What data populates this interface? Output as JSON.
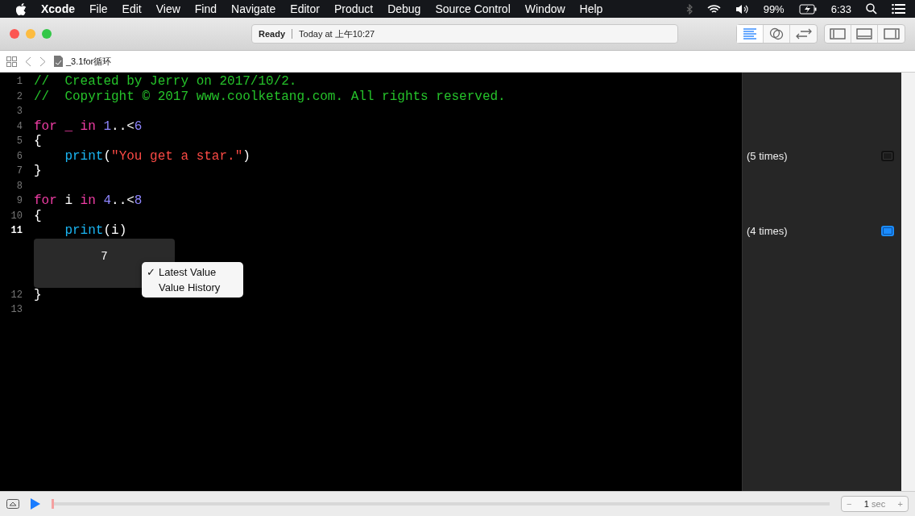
{
  "menu_bar": {
    "items": [
      {
        "label": "Xcode",
        "kind": "app"
      },
      {
        "label": "File",
        "kind": "menu"
      },
      {
        "label": "Edit",
        "kind": "menu"
      },
      {
        "label": "View",
        "kind": "menu"
      },
      {
        "label": "Find",
        "kind": "menu"
      },
      {
        "label": "Navigate",
        "kind": "menu"
      },
      {
        "label": "Editor",
        "kind": "menu"
      },
      {
        "label": "Product",
        "kind": "menu"
      },
      {
        "label": "Debug",
        "kind": "menu"
      },
      {
        "label": "Source Control",
        "kind": "menu"
      },
      {
        "label": "Window",
        "kind": "menu"
      },
      {
        "label": "Help",
        "kind": "menu"
      }
    ],
    "battery": "99%",
    "clock": "6:33"
  },
  "window": {
    "status": {
      "state": "Ready",
      "time": "Today at 上午10:27"
    },
    "editor_modes": [
      {
        "kind": "standard",
        "selected": true
      },
      {
        "kind": "assistant",
        "selected": false
      },
      {
        "kind": "version",
        "selected": false
      }
    ],
    "panels": [
      {
        "kind": "left"
      },
      {
        "kind": "bottom"
      },
      {
        "kind": "right"
      }
    ]
  },
  "breadcrumb": {
    "file": "_3.1for循环"
  },
  "code": [
    {
      "number": "1",
      "current": false,
      "tokens": [
        {
          "text": "//  Created by Jerry on 2017/10/2.",
          "kind": "comment"
        }
      ]
    },
    {
      "number": "2",
      "current": false,
      "tokens": [
        {
          "text": "//  Copyright © 2017 www.coolketang.com. All rights reserved.",
          "kind": "comment"
        }
      ]
    },
    {
      "number": "3",
      "current": false
    },
    {
      "number": "4",
      "current": false,
      "tokens": [
        {
          "text": "for",
          "kind": "keyword"
        },
        {
          "text": " _",
          "kind": "keyword"
        },
        {
          "text": " in",
          "kind": "keyword"
        },
        {
          "text": " 1",
          "kind": "number"
        },
        {
          "text": "..<",
          "kind": "plain"
        },
        {
          "text": "6",
          "kind": "number"
        }
      ]
    },
    {
      "number": "5",
      "current": false,
      "tokens": [
        {
          "text": "{",
          "kind": "plain"
        }
      ]
    },
    {
      "number": "6",
      "current": false,
      "tokens": [
        {
          "text": "    print",
          "kind": "func"
        },
        {
          "text": "(",
          "kind": "plain"
        },
        {
          "text": "\"You get a star.\"",
          "kind": "string"
        },
        {
          "text": ")",
          "kind": "plain"
        }
      ],
      "result": {
        "text": "(5 times)",
        "selected": false
      }
    },
    {
      "number": "7",
      "current": false,
      "tokens": [
        {
          "text": "}",
          "kind": "plain"
        }
      ]
    },
    {
      "number": "8",
      "current": false
    },
    {
      "number": "9",
      "current": false,
      "tokens": [
        {
          "text": "for",
          "kind": "keyword"
        },
        {
          "text": " i",
          "kind": "plain"
        },
        {
          "text": " in",
          "kind": "keyword"
        },
        {
          "text": " 4",
          "kind": "number"
        },
        {
          "text": "..<",
          "kind": "plain"
        },
        {
          "text": "8",
          "kind": "number"
        }
      ]
    },
    {
      "number": "10",
      "current": false,
      "tokens": [
        {
          "text": "{",
          "kind": "plain"
        }
      ]
    },
    {
      "number": "11",
      "current": true,
      "tokens": [
        {
          "text": "    print",
          "kind": "func"
        },
        {
          "text": "(i)",
          "kind": "plain"
        }
      ],
      "result": {
        "text": "(4 times)",
        "selected": true
      },
      "inline_result": {
        "value": "7",
        "check_symbol": "✓",
        "menu": [
          {
            "label": "Latest Value",
            "checked": true
          },
          {
            "label": "Value History",
            "checked": false
          }
        ]
      }
    },
    {
      "number": "12",
      "current": false,
      "tokens": [
        {
          "text": "}",
          "kind": "plain"
        }
      ]
    },
    {
      "number": "13",
      "current": false
    }
  ],
  "debug_bar": {
    "duration": {
      "minus": "−",
      "value": "1",
      "unit": "sec",
      "plus": "+"
    }
  }
}
